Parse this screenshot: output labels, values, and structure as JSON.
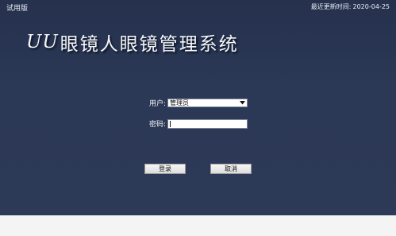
{
  "header": {
    "trial_label": "试用版",
    "update_label": "最近更新时间:",
    "update_date": "2020-04-25"
  },
  "title": {
    "brand": "UU",
    "name": "眼镜人眼镜管理系统"
  },
  "form": {
    "user_label": "用户:",
    "user_value": "管理员",
    "password_label": "密码:",
    "password_value": ""
  },
  "buttons": {
    "login": "登录",
    "cancel": "取消"
  },
  "icons": {
    "dropdown": "chevron-down-icon"
  },
  "colors": {
    "panel_background": "#2a3753",
    "text": "#f3f5f9"
  }
}
